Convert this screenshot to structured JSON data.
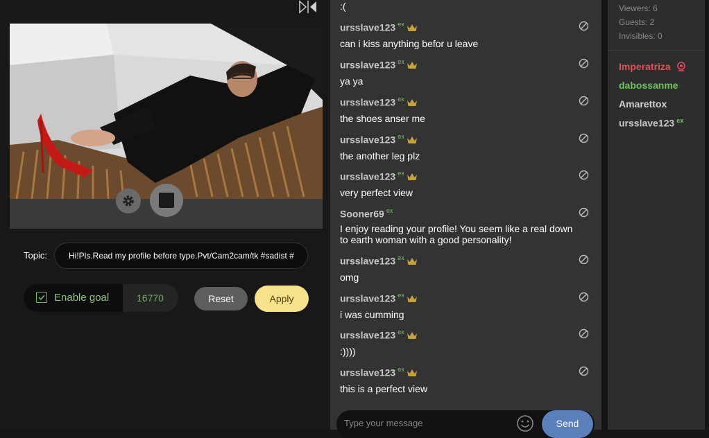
{
  "broadcast": {
    "topic_label": "Topic:",
    "topic_value": "Hi!Pls.Read my profile before type.Pvt/Cam2cam/tk  #sadist #",
    "goal_label": "Enable goal",
    "goal_checked": true,
    "goal_value": "16770",
    "reset_label": "Reset",
    "apply_label": "Apply"
  },
  "chat": {
    "top_text": ":(",
    "messages": [
      {
        "user": "ursslave123",
        "badge": "ex",
        "crown": true,
        "text": "can i kiss anything befor u leave"
      },
      {
        "user": "ursslave123",
        "badge": "ex",
        "crown": true,
        "text": "ya ya"
      },
      {
        "user": "ursslave123",
        "badge": "ex",
        "crown": true,
        "text": "the shoes anser me"
      },
      {
        "user": "ursslave123",
        "badge": "ex",
        "crown": true,
        "text": "the another leg plz"
      },
      {
        "user": "ursslave123",
        "badge": "ex",
        "crown": true,
        "text": "very perfect view"
      },
      {
        "user": "Sooner69",
        "badge": "ex",
        "crown": false,
        "text": "I enjoy reading your profile! You seem like a real down to earth woman with a good personality!"
      },
      {
        "user": "ursslave123",
        "badge": "ex",
        "crown": true,
        "text": "omg"
      },
      {
        "user": "ursslave123",
        "badge": "ex",
        "crown": true,
        "text": "i was cumming"
      },
      {
        "user": "ursslave123",
        "badge": "ex",
        "crown": true,
        "text": ":))))"
      },
      {
        "user": "ursslave123",
        "badge": "ex",
        "crown": true,
        "text": "this is a perfect view"
      }
    ],
    "input_placeholder": "Type your message",
    "send_label": "Send"
  },
  "users": {
    "viewers": "Viewers: 6",
    "guests": "Guests: 2",
    "invisibles": "Invisibles: 0",
    "list": [
      {
        "name": "Imperatriza",
        "color": "#e0505a",
        "icon": "webcam-icon"
      },
      {
        "name": "dabossanme",
        "color": "#6fc35c"
      },
      {
        "name": "Amarettox",
        "color": "#d2d2d2"
      },
      {
        "name": "ursslave123",
        "color": "#c8c8c8",
        "badge": "ex"
      }
    ]
  },
  "colors": {
    "accent_yellow": "#f5e28b",
    "send_blue": "#5b7fb9",
    "badge_green": "#76c26a",
    "crown_gold": "#c9a23a"
  }
}
